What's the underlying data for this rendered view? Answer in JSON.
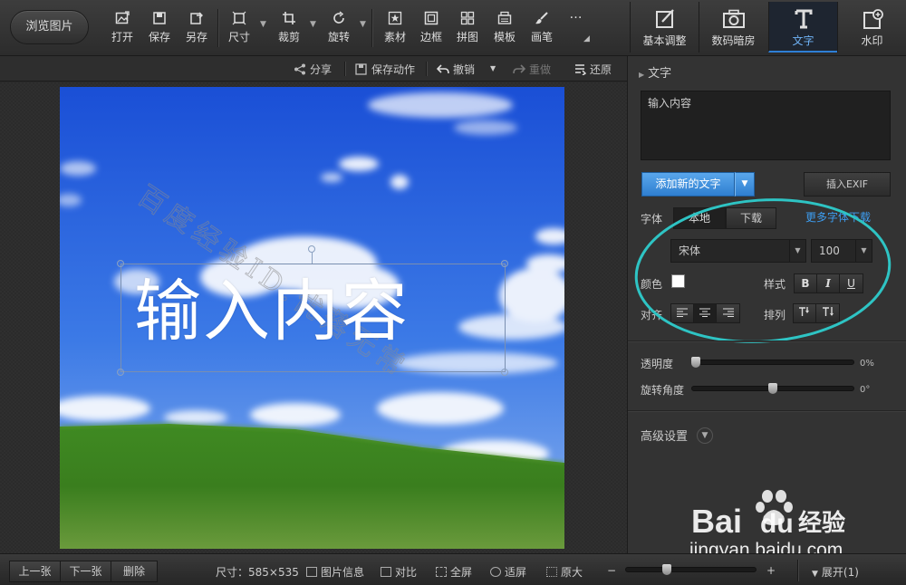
{
  "toolbar": {
    "browse_label": "浏览图片",
    "tools": [
      {
        "label": "打开",
        "icon": "open-image-icon"
      },
      {
        "label": "保存",
        "icon": "save-icon"
      },
      {
        "label": "另存",
        "icon": "save-as-icon"
      },
      {
        "label": "尺寸",
        "icon": "resize-icon"
      },
      {
        "label": "裁剪",
        "icon": "crop-icon"
      },
      {
        "label": "旋转",
        "icon": "rotate-icon"
      },
      {
        "label": "素材",
        "icon": "star-icon"
      },
      {
        "label": "边框",
        "icon": "frame-icon"
      },
      {
        "label": "拼图",
        "icon": "collage-icon"
      },
      {
        "label": "模板",
        "icon": "template-icon"
      },
      {
        "label": "画笔",
        "icon": "brush-icon"
      }
    ],
    "more_label": "…"
  },
  "right_tabs": [
    {
      "label": "基本调整",
      "icon": "adjust-icon",
      "active": false
    },
    {
      "label": "数码暗房",
      "icon": "camera-icon",
      "active": false
    },
    {
      "label": "文字",
      "icon": "text-icon",
      "active": true
    },
    {
      "label": "水印",
      "icon": "watermark-icon",
      "active": false
    }
  ],
  "subbar": {
    "share": "分享",
    "save_action": "保存动作",
    "undo": "撤销",
    "redo": "重做",
    "restore": "还原"
  },
  "canvas": {
    "overlay_text": "输入内容",
    "watermark_text": "百度经验ID:优落无常"
  },
  "panel": {
    "title": "文字",
    "text_input_value": "输入内容",
    "add_text_label": "添加新的文字",
    "insert_exif_label": "插入EXIF",
    "font_label": "字体",
    "font_source_local": "本地",
    "font_source_download": "下载",
    "more_fonts_link": "更多字体下载",
    "font_name": "宋体",
    "font_size": "100",
    "color_label": "颜色",
    "color_value": "#ffffff",
    "style_label": "样式",
    "style_buttons": [
      "B",
      "I",
      "U"
    ],
    "align_label": "对齐",
    "arrange_label": "排列",
    "opacity_label": "透明度",
    "opacity_value": "0%",
    "opacity_fraction": 0.0,
    "rotation_label": "旋转角度",
    "rotation_value": "0°",
    "rotation_fraction": 0.5,
    "advanced_label": "高级设置",
    "highlight_color": "#2ec4c4"
  },
  "bottombar": {
    "prev": "上一张",
    "next": "下一张",
    "delete": "删除",
    "size_info": "尺寸：585×535",
    "image_info": "图片信息",
    "compare": "对比",
    "fullscreen": "全屏",
    "fit": "适屏",
    "actual_size": "原大",
    "zoom_minus": "−",
    "zoom_plus": "+",
    "expand": "展开(1)"
  },
  "site_watermark": {
    "brand": "Bai",
    "brand_suffix": "du",
    "cn": "经验",
    "url": "jingyan.baidu.com"
  }
}
